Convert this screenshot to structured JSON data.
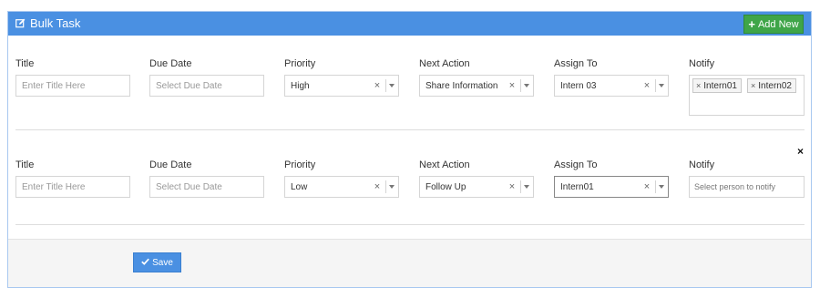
{
  "header": {
    "title": "Bulk Task",
    "add_label": "Add New"
  },
  "labels": {
    "title": "Title",
    "due_date": "Due Date",
    "priority": "Priority",
    "next_action": "Next Action",
    "assign_to": "Assign To",
    "notify": "Notify"
  },
  "rows": [
    {
      "title_placeholder": "Enter Title Here",
      "due_placeholder": "Select Due Date",
      "priority": "High",
      "next_action": "Share Information",
      "assign_to": "Intern 03",
      "notify_tags": [
        "Intern01",
        "Intern02"
      ],
      "notify_placeholder": ""
    },
    {
      "title_placeholder": "Enter Title Here",
      "due_placeholder": "Select Due Date",
      "priority": "Low",
      "next_action": "Follow Up",
      "assign_to": "Intern01",
      "notify_tags": [],
      "notify_placeholder": "Select person to notify"
    }
  ],
  "footer": {
    "save_label": "Save"
  },
  "colors": {
    "header": "#4a90e2",
    "add_button": "#3fa548",
    "save_button": "#4a90e2"
  }
}
